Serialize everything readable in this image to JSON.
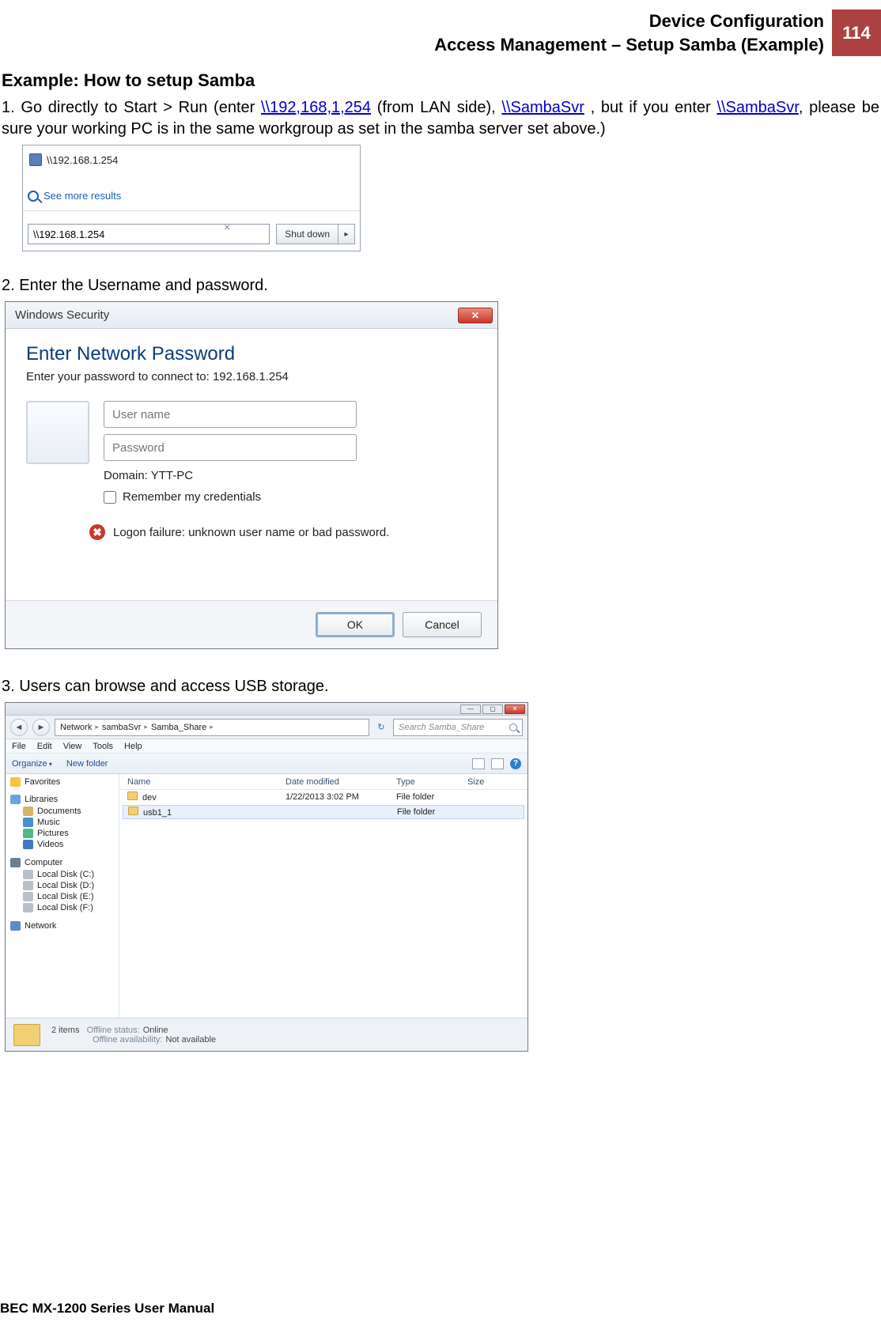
{
  "header": {
    "line1": "Device Configuration",
    "line2": "Access Management – Setup Samba (Example)",
    "page_number": "114"
  },
  "section_title": "Example: How to setup Samba",
  "step1": {
    "prefix": "1. Go directly to Start > Run (enter ",
    "link1": "\\\\192,168,1,254",
    "mid1": " (from LAN side), ",
    "link2": "\\\\SambaSvr",
    "mid2": " , but if you enter ",
    "link3": "\\\\SambaSvr",
    "suffix": ", please be sure your working PC is in the same workgroup as set in the samba server set above.)"
  },
  "fig1": {
    "result_item": "\\\\192.168.1.254",
    "see_more": "See more results",
    "search_value": "\\\\192.168.1.254",
    "shutdown_label": "Shut down"
  },
  "step2": "2. Enter the Username and password.",
  "fig2": {
    "title": "Windows Security",
    "heading": "Enter Network Password",
    "sub": "Enter your password to connect to: 192.168.1.254",
    "username_ph": "User name",
    "password_ph": "Password",
    "domain": "Domain: YTT-PC",
    "remember": "Remember my credentials",
    "error": "Logon failure: unknown user name or bad password.",
    "ok": "OK",
    "cancel": "Cancel"
  },
  "step3": "3. Users can browse and access USB storage.",
  "fig3": {
    "breadcrumb": {
      "root": "Network",
      "svr": "sambaSvr",
      "share": "Samba_Share"
    },
    "search_ph": "Search Samba_Share",
    "menu": [
      "File",
      "Edit",
      "View",
      "Tools",
      "Help"
    ],
    "organize": "Organize",
    "newfolder": "New folder",
    "columns": [
      "Name",
      "Date modified",
      "Type",
      "Size"
    ],
    "rows": [
      {
        "name": "dev",
        "date": "1/22/2013 3:02 PM",
        "type": "File folder",
        "size": ""
      },
      {
        "name": "usb1_1",
        "date": "",
        "type": "File folder",
        "size": ""
      }
    ],
    "sidebar": {
      "favorites": "Favorites",
      "libraries": "Libraries",
      "lib_items": [
        "Documents",
        "Music",
        "Pictures",
        "Videos"
      ],
      "computer": "Computer",
      "disks": [
        "Local Disk (C:)",
        "Local Disk (D:)",
        "Local Disk (E:)",
        "Local Disk (F:)"
      ],
      "network": "Network"
    },
    "status": {
      "count": "2 items",
      "k1": "Offline status:",
      "v1": "Online",
      "k2": "Offline availability:",
      "v2": "Not available"
    }
  },
  "footer": "BEC MX-1200 Series User Manual"
}
